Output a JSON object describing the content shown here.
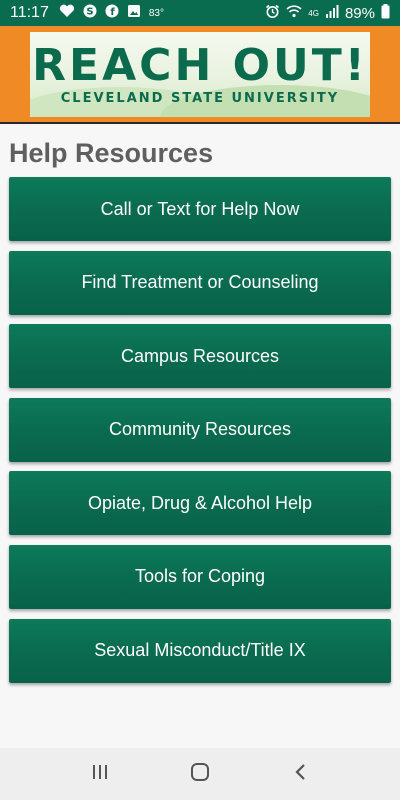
{
  "status_bar": {
    "time": "11:17",
    "temperature": "83°",
    "battery": "89%",
    "network": "4G"
  },
  "banner": {
    "title": "REACH OUT!",
    "subtitle": "CLEVELAND STATE UNIVERSITY"
  },
  "page": {
    "title": "Help Resources"
  },
  "menu": {
    "items": [
      {
        "label": "Call or Text for Help Now"
      },
      {
        "label": "Find Treatment or Counseling"
      },
      {
        "label": "Campus Resources"
      },
      {
        "label": "Community Resources"
      },
      {
        "label": "Opiate, Drug & Alcohol Help"
      },
      {
        "label": "Tools for Coping"
      },
      {
        "label": "Sexual Misconduct/Title IX"
      }
    ]
  },
  "colors": {
    "status_bar": "#0a6c4f",
    "banner_orange": "#f08a24",
    "button_green": "#0a6a4e",
    "title_gray": "#5f5f5f"
  },
  "icons": [
    "iheart-icon",
    "shazam-icon",
    "facebook-icon",
    "gallery-icon",
    "alarm-icon",
    "wifi-icon",
    "signal-icon",
    "battery-icon",
    "recents-icon",
    "home-icon",
    "back-icon"
  ]
}
